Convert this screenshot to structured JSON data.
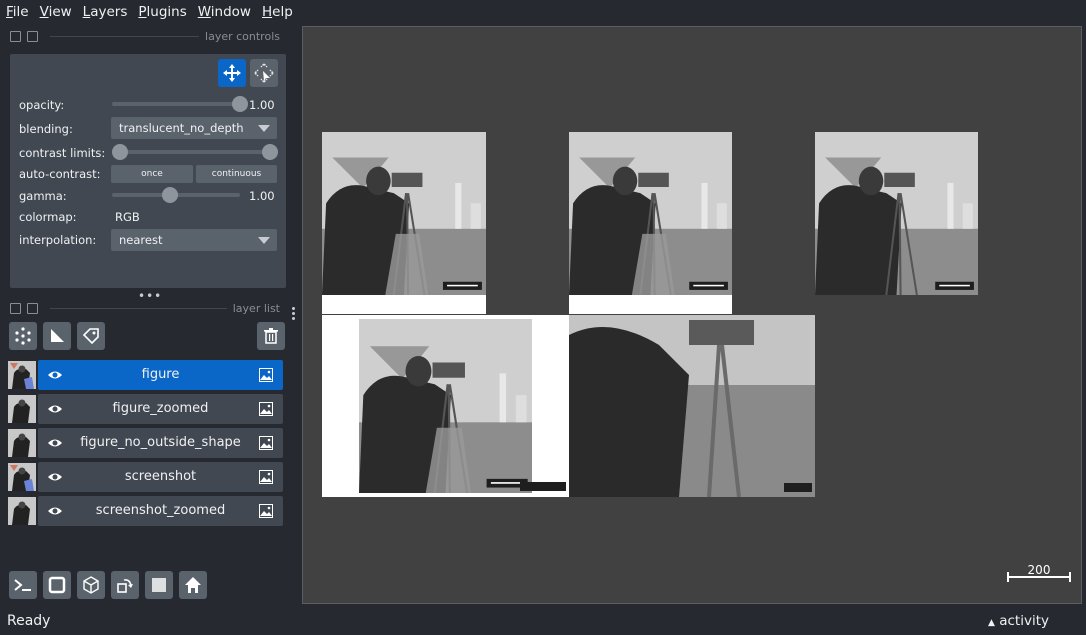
{
  "menu": [
    {
      "underline": "F",
      "rest": "ile"
    },
    {
      "underline": "V",
      "rest": "iew"
    },
    {
      "underline": "L",
      "rest": "ayers"
    },
    {
      "underline": "P",
      "rest": "lugins"
    },
    {
      "underline": "W",
      "rest": "indow"
    },
    {
      "underline": "H",
      "rest": "elp"
    }
  ],
  "dock": {
    "layer_controls_title": "layer controls",
    "layer_list_title": "layer list"
  },
  "controls": {
    "opacity_label": "opacity:",
    "opacity_value": "1.00",
    "opacity_fraction": 1.0,
    "blending_label": "blending:",
    "blending_value": "translucent_no_depth",
    "contrast_label": "contrast limits:",
    "contrast_range": [
      0.0,
      1.0
    ],
    "auto_contrast_label": "auto-contrast:",
    "auto_once": "once",
    "auto_continuous": "continuous",
    "gamma_label": "gamma:",
    "gamma_value": "1.00",
    "gamma_fraction": 0.45,
    "colormap_label": "colormap:",
    "colormap_value": "RGB",
    "interpolation_label": "interpolation:",
    "interpolation_value": "nearest"
  },
  "layers": [
    {
      "name": "figure",
      "selected": true
    },
    {
      "name": "figure_zoomed",
      "selected": false
    },
    {
      "name": "figure_no_outside_shape",
      "selected": false
    },
    {
      "name": "screenshot",
      "selected": false
    },
    {
      "name": "screenshot_zoomed",
      "selected": false
    }
  ],
  "canvas": {
    "scale_bar_label": "200",
    "background_color": "#414141"
  },
  "status": {
    "text": "Ready",
    "activity": "activity"
  },
  "colors": {
    "accent": "#0a67c8",
    "panel": "#414851",
    "button": "#5a626c",
    "background": "#262930"
  }
}
